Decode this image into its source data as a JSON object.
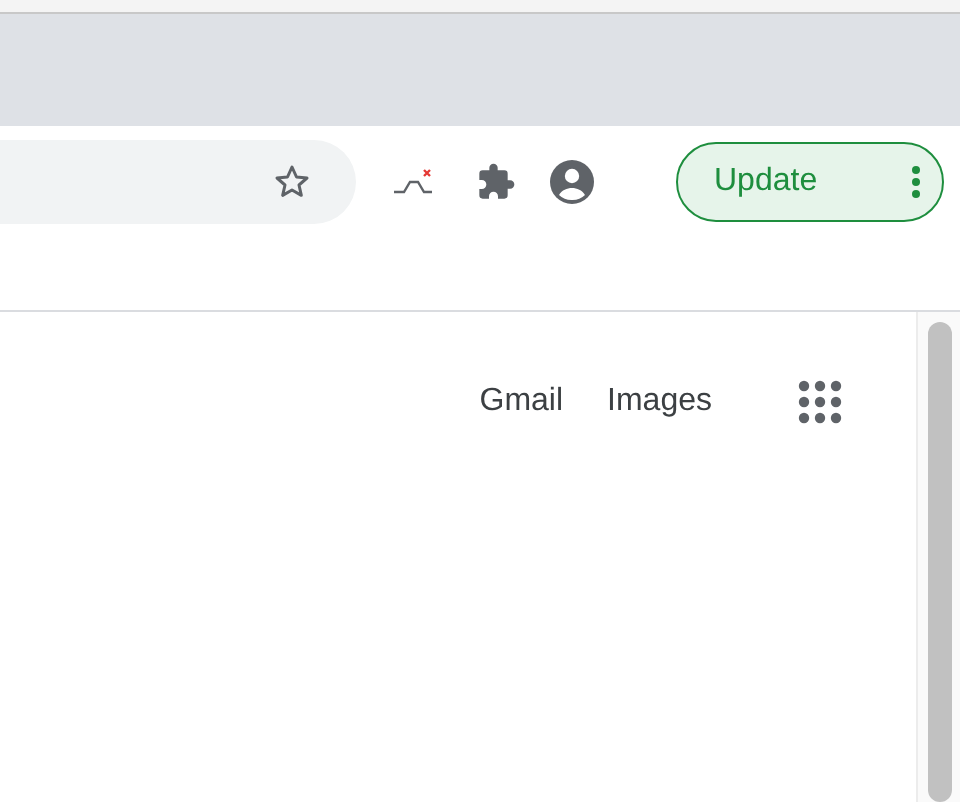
{
  "toolbar": {
    "update_button": {
      "label": "Update"
    }
  },
  "header_links": [
    {
      "label": "Gmail"
    },
    {
      "label": "Images"
    }
  ]
}
